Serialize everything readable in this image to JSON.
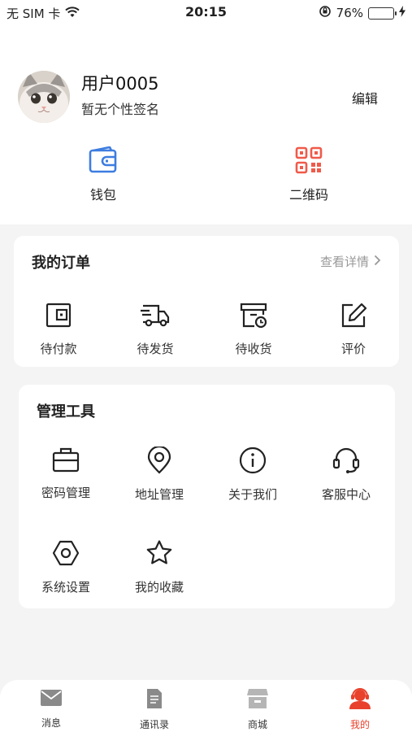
{
  "status_bar": {
    "carrier": "无 SIM 卡",
    "time": "20:15",
    "battery": "76%",
    "battery_level": 0.76
  },
  "profile": {
    "username": "用户0005",
    "signature": "暂无个性签名",
    "edit_label": "编辑"
  },
  "quick": {
    "wallet": "钱包",
    "qrcode": "二维码"
  },
  "orders": {
    "title": "我的订单",
    "more": "查看详情",
    "items": [
      "待付款",
      "待发货",
      "待收货",
      "评价"
    ]
  },
  "tools": {
    "title": "管理工具",
    "items": [
      "密码管理",
      "地址管理",
      "关于我们",
      "客服中心",
      "系统设置",
      "我的收藏"
    ]
  },
  "tabs": [
    "消息",
    "通讯录",
    "商城",
    "我的"
  ],
  "colors": {
    "accent_red": "#e8412c",
    "wallet_blue": "#3d7de0",
    "qr_red": "#f05a4a"
  }
}
